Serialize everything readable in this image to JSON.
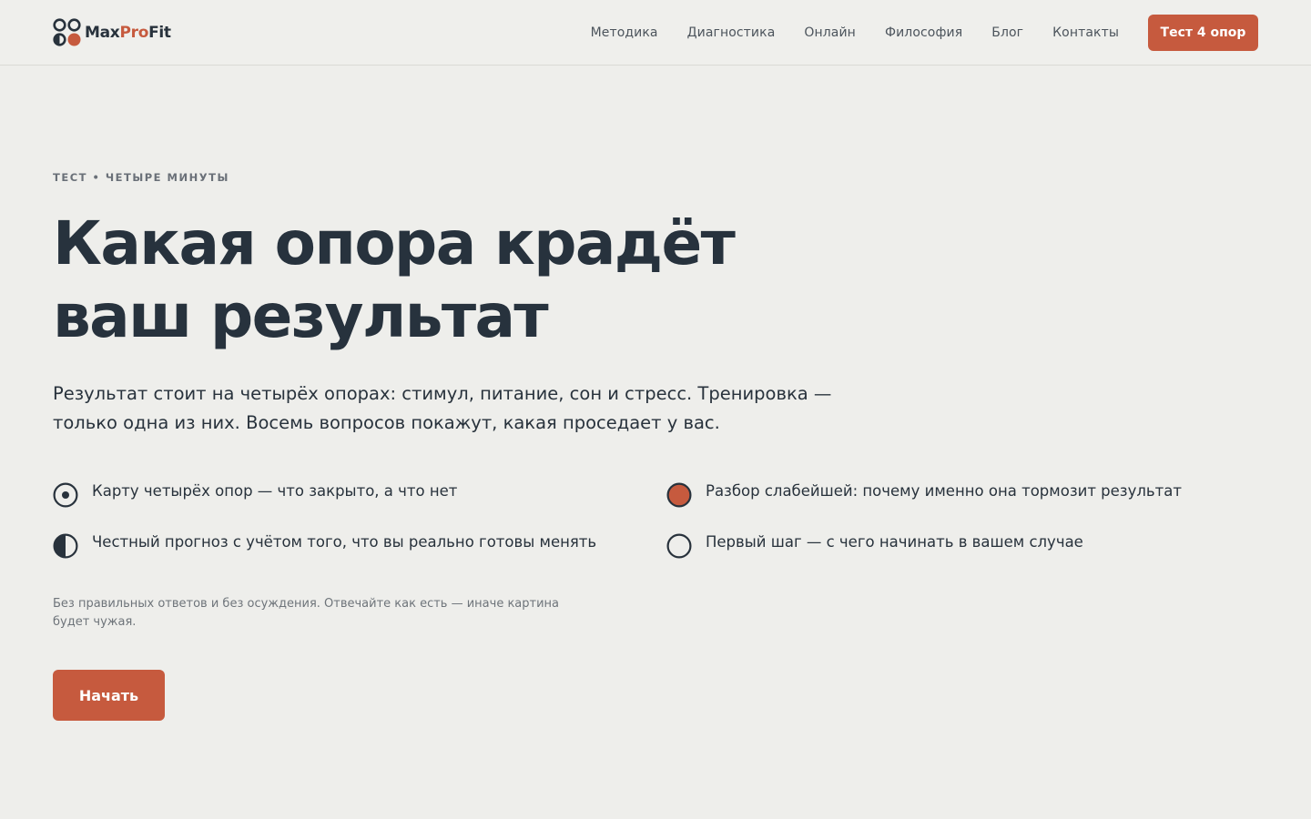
{
  "brand": {
    "name_main": "Max",
    "name_accent": "Pro",
    "name_tail": "Fit",
    "icon": "four-circles-logo-icon",
    "accent_color": "#c65a3e",
    "ink_color": "#28323c"
  },
  "nav": {
    "items": [
      {
        "label": "Методика"
      },
      {
        "label": "Диагностика"
      },
      {
        "label": "Онлайн"
      },
      {
        "label": "Философия"
      },
      {
        "label": "Блог"
      },
      {
        "label": "Контакты"
      }
    ],
    "cta_label": "Тест 4 опор"
  },
  "hero": {
    "eyebrow": "ТЕСТ • ЧЕТЫРЕ МИНУТЫ",
    "title": "Какая опора крадёт ваш результат",
    "lead": "Результат стоит на четырёх опорах: стимул, питание, сон и стресс. Тренировка — только одна из них. Восемь вопросов покажут, какая проседает у вас."
  },
  "features": [
    {
      "icon": "target-circle-icon",
      "text": "Карту четырёх опор — что закрыто, а что нет"
    },
    {
      "icon": "filled-circle-icon",
      "text": "Разбор слабейшей: почему именно она тормозит результат"
    },
    {
      "icon": "half-circle-icon",
      "text": "Честный прогноз с учётом того, что вы реально готовы менять"
    },
    {
      "icon": "empty-circle-icon",
      "text": "Первый шаг — с чего начинать в вашем случае"
    }
  ],
  "note": "Без правильных ответов и без осуждения. Отвечайте как есть — иначе картина будет чужая.",
  "start_button": "Начать"
}
